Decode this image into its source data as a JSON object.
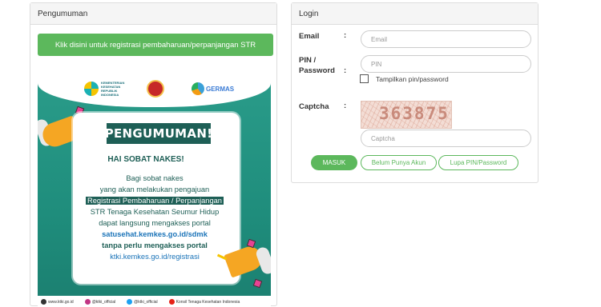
{
  "announcement": {
    "header": "Pengumuman",
    "register_button": "Klik disini untuk registrasi pembaharuan/perpanjangan STR",
    "poster": {
      "title": "PENGUMUMAN!",
      "greeting": "HAI SOBAT NAKES!",
      "lines": [
        "Bagi sobat nakes",
        "yang akan melakukan pengajuan",
        "Registrasi Pembaharuan / Perpanjangan",
        "STR Tenaga Kesehatan Seumur Hidup",
        "dapat langsung mengakses portal",
        "satusehat.kemkes.go.id/sdmk",
        "tanpa perlu mengakses portal",
        "ktki.kemkes.go.id/registrasi"
      ],
      "footer": [
        "www.ktki.go.id",
        "@ktki_official",
        "@ktki_official",
        "Konsil Tenaga Kesehatan Indonesia"
      ]
    }
  },
  "login": {
    "header": "Login",
    "email_label": "Email",
    "email_placeholder": "Email",
    "pin_label_1": "PIN /",
    "pin_label_2": "Password",
    "pin_placeholder": "PIN",
    "show_pin_label": "Tampilkan pin/password",
    "captcha_label": "Captcha",
    "captcha_code": "363875",
    "captcha_placeholder": "Captcha",
    "colon": ":",
    "buttons": {
      "login": "MASUK",
      "no_account": "Belum Punya Akun",
      "forgot": "Lupa PIN/Password"
    }
  },
  "colors": {
    "accent_green": "#5cb85c",
    "poster_teal": "#2a9c8a",
    "poster_dark": "#1e5f56",
    "link_blue": "#1a73b8"
  }
}
